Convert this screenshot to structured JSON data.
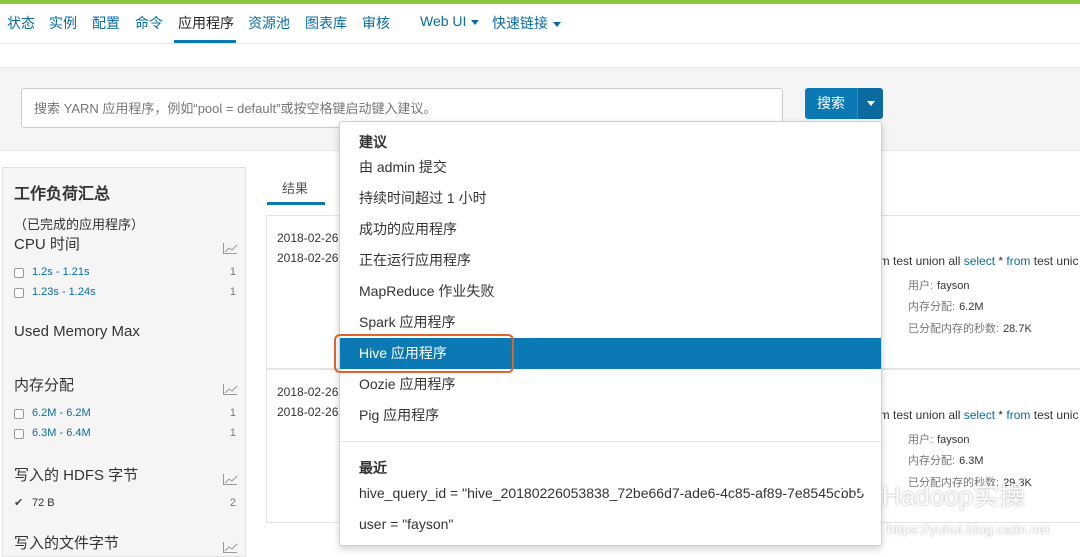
{
  "nav": {
    "items": [
      {
        "label": "状态"
      },
      {
        "label": "实例"
      },
      {
        "label": "配置"
      },
      {
        "label": "命令"
      },
      {
        "label": "应用程序"
      },
      {
        "label": "资源池"
      },
      {
        "label": "图表库"
      },
      {
        "label": "审核"
      },
      {
        "label": "Web UI"
      },
      {
        "label": "快速链接"
      }
    ],
    "active": "应用程序"
  },
  "search": {
    "placeholder": "搜索 YARN 应用程序，例如“pool = default”或按空格键启动键入建议。",
    "button_label": "搜索"
  },
  "left_panel": {
    "title": "工作负荷汇总",
    "subtitle": "（已完成的应用程序）",
    "sections": [
      {
        "title": "CPU 时间",
        "rows": [
          {
            "label": "1.2s - 1.21s",
            "count": "1"
          },
          {
            "label": "1.23s - 1.24s",
            "count": "1"
          }
        ]
      },
      {
        "title": "Used Memory Max",
        "rows": []
      },
      {
        "title": "内存分配",
        "rows": [
          {
            "label": "6.2M - 6.2M",
            "count": "1"
          },
          {
            "label": "6.3M - 6.4M",
            "count": "1"
          }
        ]
      },
      {
        "title": "写入的 HDFS 字节",
        "rows": [
          {
            "label": "72 B",
            "count": "2"
          }
        ]
      },
      {
        "title": "写入的文件字节",
        "rows": []
      }
    ]
  },
  "results": {
    "tab_label": "结果",
    "cards": [
      {
        "dates": [
          "2018-02-26",
          "2018-02-26"
        ],
        "sql": {
          "pre": "om test union all ",
          "kw1": "select",
          "mid": " * ",
          "kw2": "from",
          "post": " test unic"
        },
        "meta": [
          {
            "key": "用户:",
            "value": "fayson"
          },
          {
            "key": "内存分配:",
            "value": "6.2M"
          },
          {
            "key": "已分配内存的秒数:",
            "value": "28.7K"
          }
        ]
      },
      {
        "dates": [
          "2018-02-26",
          "2018-02-26"
        ],
        "sql": {
          "pre": "om test union all ",
          "kw1": "select",
          "mid": " * ",
          "kw2": "from",
          "post": " test unic"
        },
        "meta": [
          {
            "key": "用户:",
            "value": "fayson"
          },
          {
            "key": "内存分配:",
            "value": "6.3M"
          },
          {
            "key": "已分配内存的秒数:",
            "value": "29.3K"
          }
        ]
      }
    ]
  },
  "dropdown": {
    "suggest_header": "建议",
    "suggestions": [
      {
        "label": "由 admin 提交"
      },
      {
        "label": "持续时间超过 1 小时"
      },
      {
        "label": "成功的应用程序"
      },
      {
        "label": "正在运行应用程序"
      },
      {
        "label": "MapReduce 作业失败"
      },
      {
        "label": "Spark 应用程序"
      },
      {
        "label": "Hive 应用程序"
      },
      {
        "label": "Oozie 应用程序"
      },
      {
        "label": "Pig 应用程序"
      }
    ],
    "selected": "Hive 应用程序",
    "recent_header": "最近",
    "recent": [
      {
        "label": "hive_query_id = \"hive_20180226053838_72be66d7-ade6-4c85-af89-7e8545cbb5"
      },
      {
        "label": "user = \"fayson\""
      }
    ]
  },
  "watermark": {
    "brand": "Hadoop实操",
    "url": "https://yuhui.blog.csdn.net"
  },
  "colors": {
    "accent": "#0b79b3",
    "link": "#0a6ca3",
    "top_bar": "#8cc63f",
    "highlight_box": "#e0632d"
  }
}
